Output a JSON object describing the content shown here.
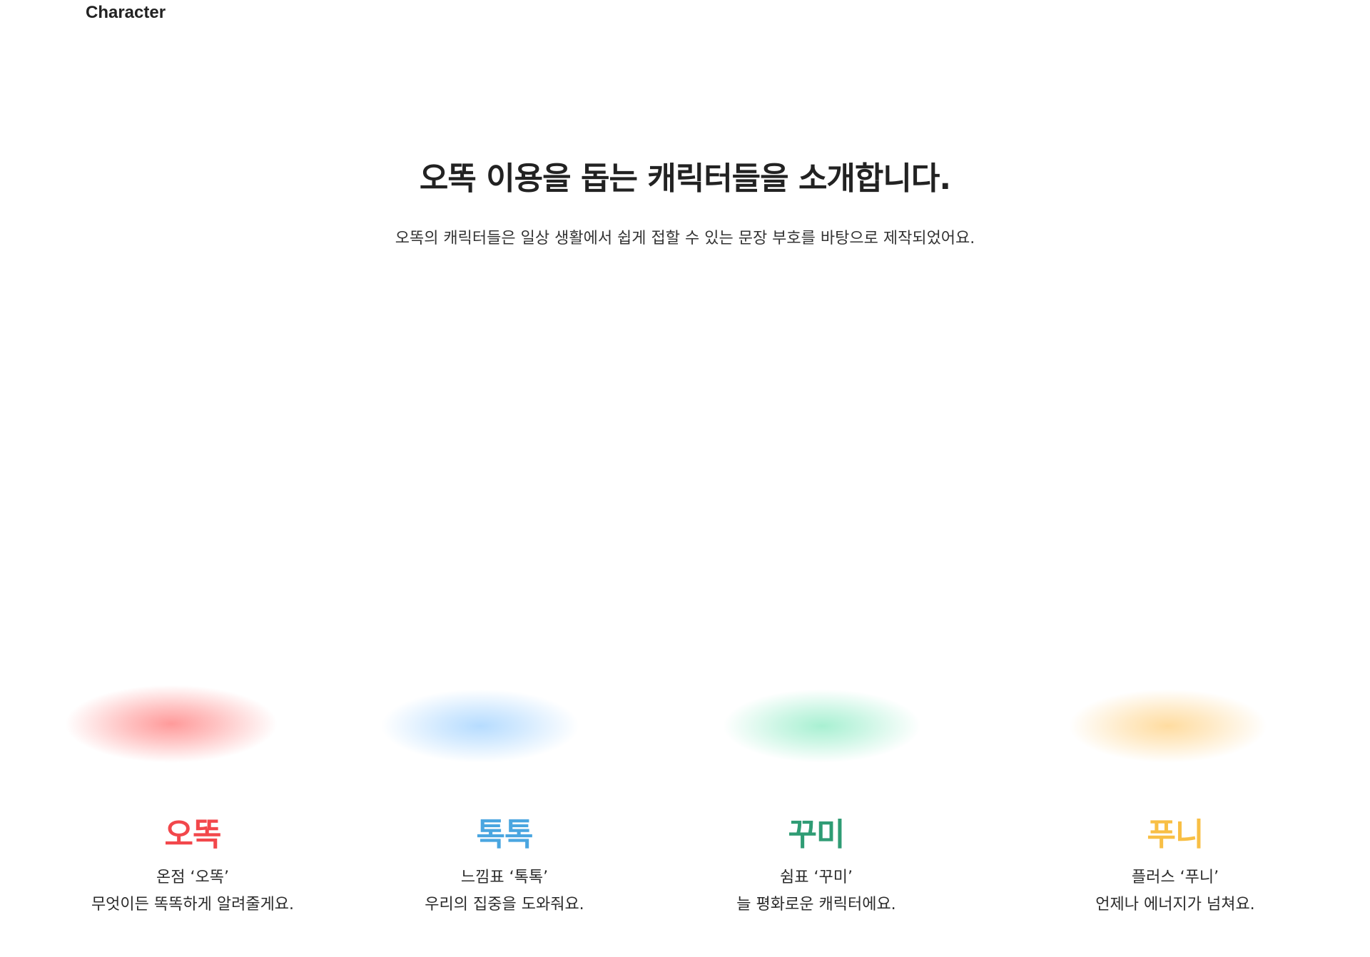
{
  "section_label": "Character",
  "headline": "오똑 이용을 돕는 캐릭터들을 소개합니다.",
  "subhead": "오똑의 캐릭터들은 일상 생활에서 쉽게 접할 수 있는 문장 부호를 바탕으로 제작되었어요.",
  "characters": [
    {
      "name": "오똑",
      "line1": "온점 ‘오똑’",
      "line2": "무엇이든 똑똑하게 알려줄게요.",
      "color": "#f2474b",
      "glow_color": "#ff9a9a"
    },
    {
      "name": "톡톡",
      "line1": "느낌표 ‘톡톡’",
      "line2": "우리의 집중을 도와줘요.",
      "color": "#4aa6e0",
      "glow_color": "#b6dcff"
    },
    {
      "name": "꾸미",
      "line1": "쉼표 ‘꾸미’",
      "line2": "늘 평화로운 캐릭터에요.",
      "color": "#2f9c74",
      "glow_color": "#a8f0d2"
    },
    {
      "name": "푸니",
      "line1": "플러스 ‘푸니’",
      "line2": "언제나 에너지가 넘쳐요.",
      "color": "#f8bf45",
      "glow_color": "#ffdca0"
    }
  ]
}
